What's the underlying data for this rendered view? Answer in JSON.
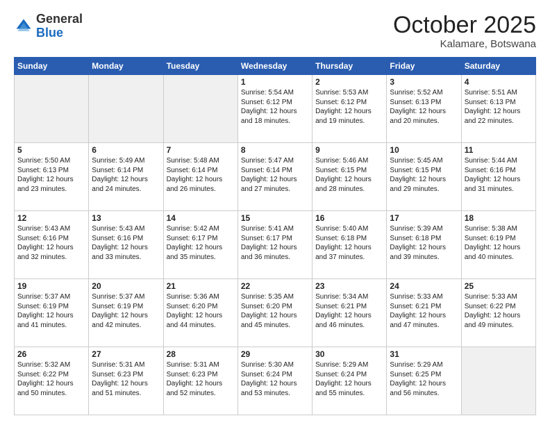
{
  "logo": {
    "general": "General",
    "blue": "Blue"
  },
  "header": {
    "month": "October 2025",
    "location": "Kalamare, Botswana"
  },
  "weekdays": [
    "Sunday",
    "Monday",
    "Tuesday",
    "Wednesday",
    "Thursday",
    "Friday",
    "Saturday"
  ],
  "weeks": [
    [
      {
        "day": "",
        "empty": true
      },
      {
        "day": "",
        "empty": true
      },
      {
        "day": "",
        "empty": true
      },
      {
        "day": "1",
        "sunrise": "5:54 AM",
        "sunset": "6:12 PM",
        "daylight": "12 hours and 18 minutes."
      },
      {
        "day": "2",
        "sunrise": "5:53 AM",
        "sunset": "6:12 PM",
        "daylight": "12 hours and 19 minutes."
      },
      {
        "day": "3",
        "sunrise": "5:52 AM",
        "sunset": "6:13 PM",
        "daylight": "12 hours and 20 minutes."
      },
      {
        "day": "4",
        "sunrise": "5:51 AM",
        "sunset": "6:13 PM",
        "daylight": "12 hours and 22 minutes."
      }
    ],
    [
      {
        "day": "5",
        "sunrise": "5:50 AM",
        "sunset": "6:13 PM",
        "daylight": "12 hours and 23 minutes."
      },
      {
        "day": "6",
        "sunrise": "5:49 AM",
        "sunset": "6:14 PM",
        "daylight": "12 hours and 24 minutes."
      },
      {
        "day": "7",
        "sunrise": "5:48 AM",
        "sunset": "6:14 PM",
        "daylight": "12 hours and 26 minutes."
      },
      {
        "day": "8",
        "sunrise": "5:47 AM",
        "sunset": "6:14 PM",
        "daylight": "12 hours and 27 minutes."
      },
      {
        "day": "9",
        "sunrise": "5:46 AM",
        "sunset": "6:15 PM",
        "daylight": "12 hours and 28 minutes."
      },
      {
        "day": "10",
        "sunrise": "5:45 AM",
        "sunset": "6:15 PM",
        "daylight": "12 hours and 29 minutes."
      },
      {
        "day": "11",
        "sunrise": "5:44 AM",
        "sunset": "6:16 PM",
        "daylight": "12 hours and 31 minutes."
      }
    ],
    [
      {
        "day": "12",
        "sunrise": "5:43 AM",
        "sunset": "6:16 PM",
        "daylight": "12 hours and 32 minutes."
      },
      {
        "day": "13",
        "sunrise": "5:43 AM",
        "sunset": "6:16 PM",
        "daylight": "12 hours and 33 minutes."
      },
      {
        "day": "14",
        "sunrise": "5:42 AM",
        "sunset": "6:17 PM",
        "daylight": "12 hours and 35 minutes."
      },
      {
        "day": "15",
        "sunrise": "5:41 AM",
        "sunset": "6:17 PM",
        "daylight": "12 hours and 36 minutes."
      },
      {
        "day": "16",
        "sunrise": "5:40 AM",
        "sunset": "6:18 PM",
        "daylight": "12 hours and 37 minutes."
      },
      {
        "day": "17",
        "sunrise": "5:39 AM",
        "sunset": "6:18 PM",
        "daylight": "12 hours and 39 minutes."
      },
      {
        "day": "18",
        "sunrise": "5:38 AM",
        "sunset": "6:19 PM",
        "daylight": "12 hours and 40 minutes."
      }
    ],
    [
      {
        "day": "19",
        "sunrise": "5:37 AM",
        "sunset": "6:19 PM",
        "daylight": "12 hours and 41 minutes."
      },
      {
        "day": "20",
        "sunrise": "5:37 AM",
        "sunset": "6:19 PM",
        "daylight": "12 hours and 42 minutes."
      },
      {
        "day": "21",
        "sunrise": "5:36 AM",
        "sunset": "6:20 PM",
        "daylight": "12 hours and 44 minutes."
      },
      {
        "day": "22",
        "sunrise": "5:35 AM",
        "sunset": "6:20 PM",
        "daylight": "12 hours and 45 minutes."
      },
      {
        "day": "23",
        "sunrise": "5:34 AM",
        "sunset": "6:21 PM",
        "daylight": "12 hours and 46 minutes."
      },
      {
        "day": "24",
        "sunrise": "5:33 AM",
        "sunset": "6:21 PM",
        "daylight": "12 hours and 47 minutes."
      },
      {
        "day": "25",
        "sunrise": "5:33 AM",
        "sunset": "6:22 PM",
        "daylight": "12 hours and 49 minutes."
      }
    ],
    [
      {
        "day": "26",
        "sunrise": "5:32 AM",
        "sunset": "6:22 PM",
        "daylight": "12 hours and 50 minutes."
      },
      {
        "day": "27",
        "sunrise": "5:31 AM",
        "sunset": "6:23 PM",
        "daylight": "12 hours and 51 minutes."
      },
      {
        "day": "28",
        "sunrise": "5:31 AM",
        "sunset": "6:23 PM",
        "daylight": "12 hours and 52 minutes."
      },
      {
        "day": "29",
        "sunrise": "5:30 AM",
        "sunset": "6:24 PM",
        "daylight": "12 hours and 53 minutes."
      },
      {
        "day": "30",
        "sunrise": "5:29 AM",
        "sunset": "6:24 PM",
        "daylight": "12 hours and 55 minutes."
      },
      {
        "day": "31",
        "sunrise": "5:29 AM",
        "sunset": "6:25 PM",
        "daylight": "12 hours and 56 minutes."
      },
      {
        "day": "",
        "empty": true
      }
    ]
  ]
}
